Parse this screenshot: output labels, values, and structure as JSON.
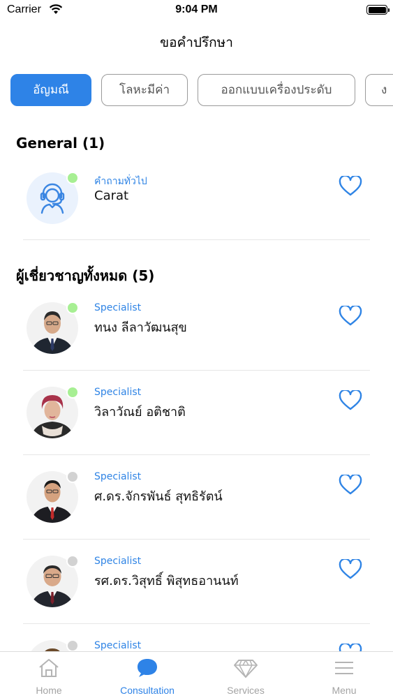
{
  "status_bar": {
    "carrier": "Carrier",
    "time": "9:04 PM"
  },
  "header": {
    "title": "ขอคำปรึกษา"
  },
  "categories": [
    {
      "label": "อัญมณี",
      "active": true
    },
    {
      "label": "โลหะมีค่า",
      "active": false
    },
    {
      "label": "ออกแบบเครื่องประดับ",
      "active": false
    },
    {
      "label": "ง",
      "active": false
    }
  ],
  "general": {
    "title": "General (1)",
    "items": [
      {
        "role": "คำถามทั่วไป",
        "name": "Carat",
        "online": true,
        "avatar": "support-agent-icon"
      }
    ]
  },
  "experts": {
    "title": "ผู้เชี่ยวชาญทั้งหมด (5)",
    "items": [
      {
        "role": "Specialist",
        "name": "ทนง ลีลาวัฒนสุข",
        "online": true
      },
      {
        "role": "Specialist",
        "name": "วิลาวัณย์ อติชาติ",
        "online": true
      },
      {
        "role": "Specialist",
        "name": "ศ.ดร.จักรพันธ์  สุทธิรัตน์",
        "online": false
      },
      {
        "role": "Specialist",
        "name": "รศ.ดร.วิสุทธิ์  พิสุทธอานนท์",
        "online": false
      },
      {
        "role": "Specialist",
        "name": "",
        "online": false
      }
    ]
  },
  "tab_bar": [
    {
      "label": "Home",
      "icon": "home-icon",
      "active": false
    },
    {
      "label": "Consultation",
      "icon": "chat-bubble-icon",
      "active": true
    },
    {
      "label": "Services",
      "icon": "diamond-icon",
      "active": false
    },
    {
      "label": "Menu",
      "icon": "menu-icon",
      "active": false
    }
  ],
  "colors": {
    "accent": "#2e83e7",
    "online": "#a7ef93",
    "offline": "#d2d2d2"
  }
}
